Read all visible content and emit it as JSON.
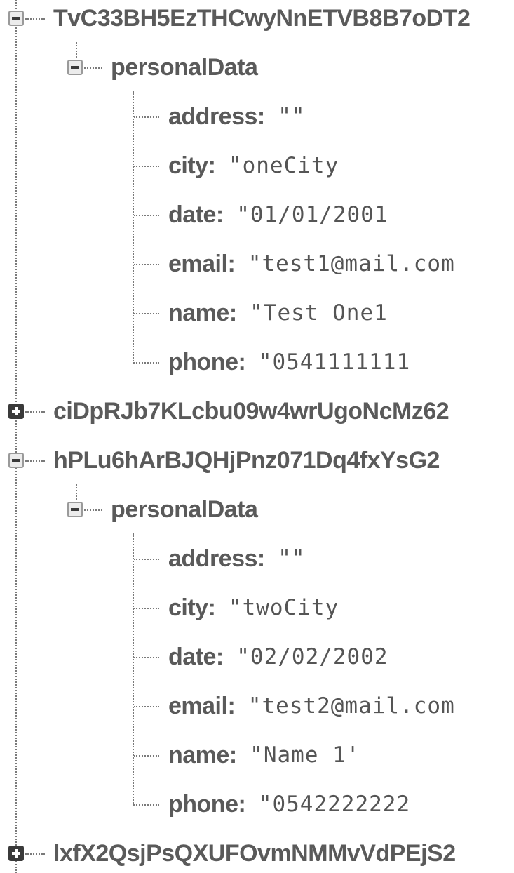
{
  "tree": {
    "nodes": [
      {
        "key": "TvC33BH5EzTHCwyNnETVB8B7oDT2",
        "expanded": true,
        "child_key": "personalData",
        "fields": [
          {
            "key": "address",
            "value": "\"\""
          },
          {
            "key": "city",
            "value": "\"oneCity"
          },
          {
            "key": "date",
            "value": "\"01/01/2001"
          },
          {
            "key": "email",
            "value": "\"test1@mail.com"
          },
          {
            "key": "name",
            "value": "\"Test One1"
          },
          {
            "key": "phone",
            "value": "\"0541111111"
          }
        ]
      },
      {
        "key": "ciDpRJb7KLcbu09w4wrUgoNcMz62",
        "expanded": false
      },
      {
        "key": "hPLu6hArBJQHjPnz071Dq4fxYsG2",
        "expanded": true,
        "child_key": "personalData",
        "fields": [
          {
            "key": "address",
            "value": "\"\""
          },
          {
            "key": "city",
            "value": "\"twoCity"
          },
          {
            "key": "date",
            "value": "\"02/02/2002"
          },
          {
            "key": "email",
            "value": "\"test2@mail.com"
          },
          {
            "key": "name",
            "value": "\"Name 1'"
          },
          {
            "key": "phone",
            "value": "\"0542222222"
          }
        ]
      },
      {
        "key": "lxfX2QsjPsQXUFOvmNMMvVdPEjS2",
        "expanded": false
      }
    ],
    "colon": ":"
  },
  "icons": {
    "collapse": "collapse-minus-icon",
    "expand": "expand-plus-icon"
  }
}
